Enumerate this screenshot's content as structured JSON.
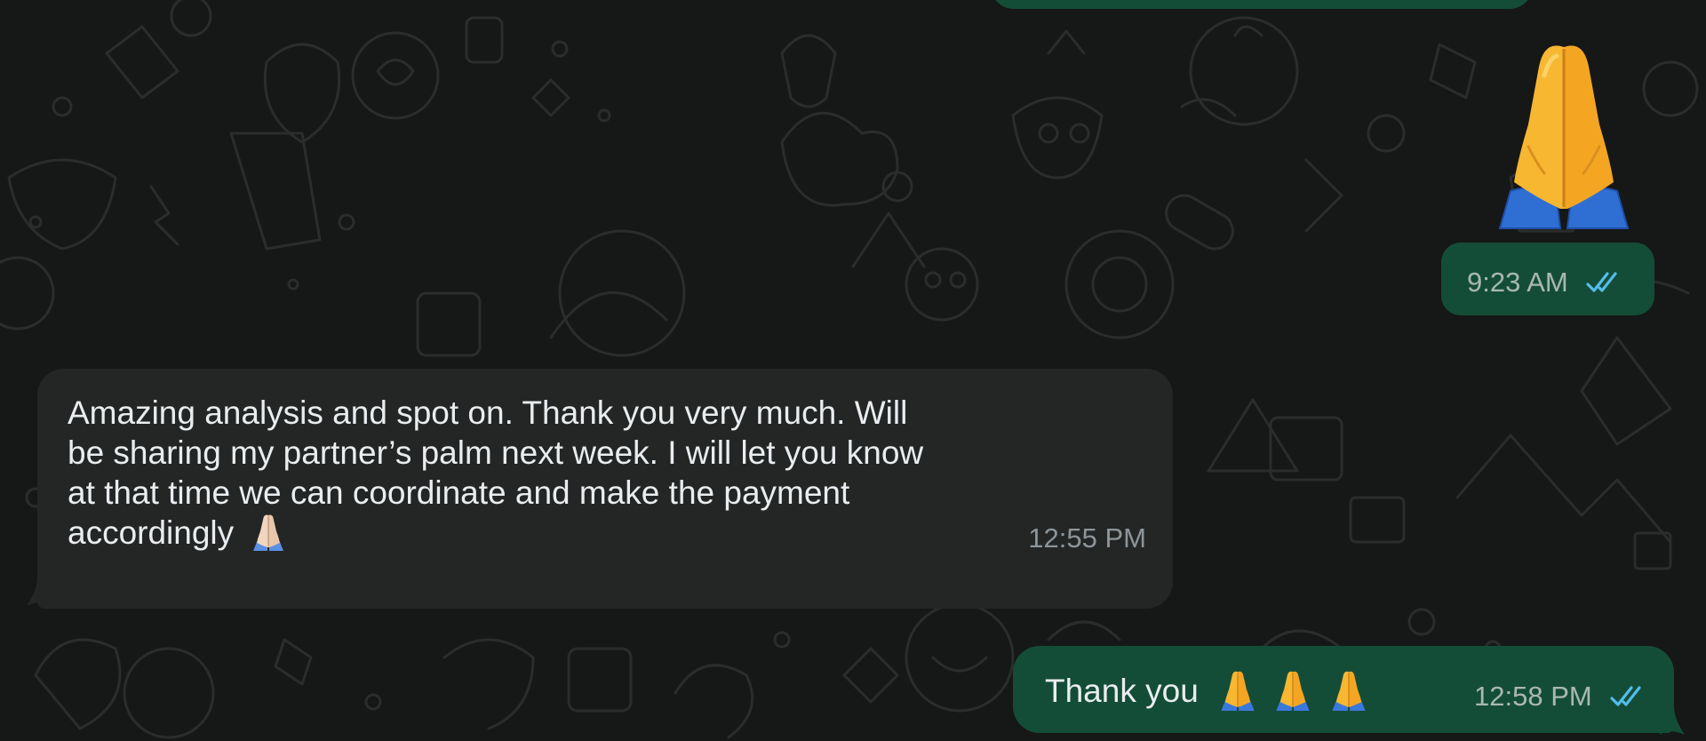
{
  "messages": [
    {
      "direction": "outgoing",
      "kind": "emoji",
      "emoji_icon": "folded-hands-icon",
      "time": "9:23 AM",
      "status": "read"
    },
    {
      "direction": "incoming",
      "kind": "text",
      "lines": [
        "Amazing analysis and spot on. Thank you very much. Will",
        "be sharing my partner’s palm next week. I will let you know",
        "at that time we can coordinate and make the payment",
        "accordingly"
      ],
      "emoji_icon": "folded-hands-icon",
      "time": "12:55 PM"
    },
    {
      "direction": "outgoing",
      "kind": "text",
      "text": "Thank you",
      "emoji_icons": [
        "folded-hands-icon",
        "folded-hands-icon",
        "folded-hands-icon"
      ],
      "time": "12:58 PM",
      "status": "read"
    }
  ],
  "theme": {
    "outgoing_bubble": "#144d37",
    "incoming_bubble": "#242626",
    "background": "#161717",
    "read_tick": "#53bdeb",
    "text": "#e9edef"
  }
}
